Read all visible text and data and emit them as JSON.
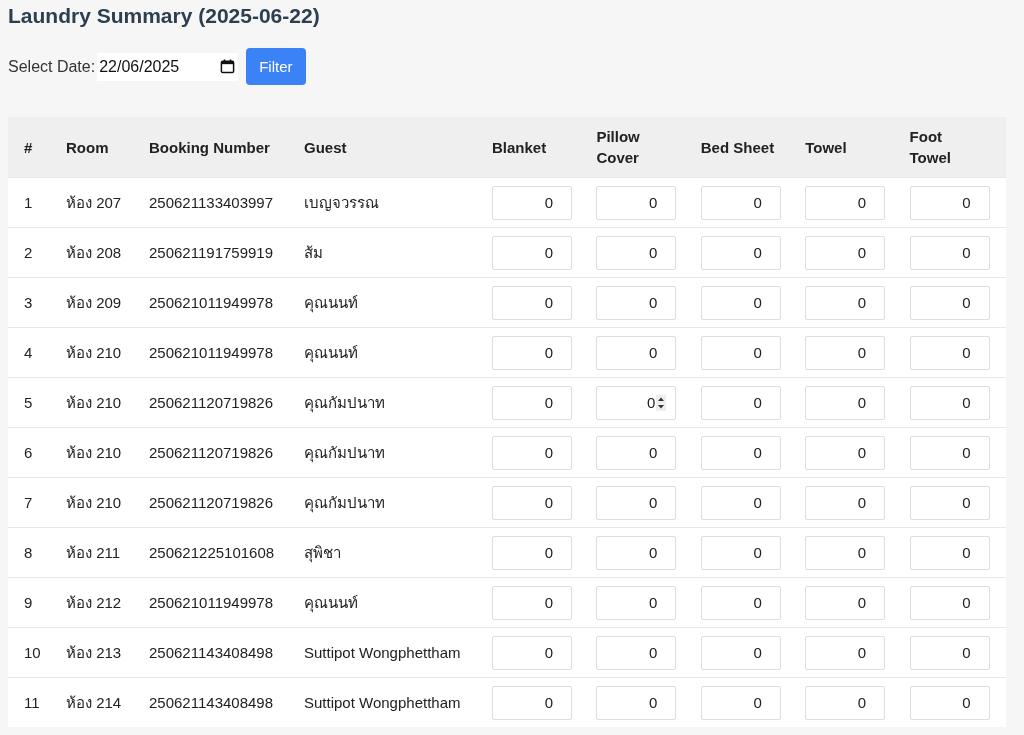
{
  "title": "Laundry Summary (2025-06-22)",
  "filter": {
    "label": "Select Date:",
    "date": "22/06/2025",
    "button": "Filter"
  },
  "table": {
    "columns": [
      "#",
      "Room",
      "Booking Number",
      "Guest",
      "Blanket",
      "Pillow Cover",
      "Bed Sheet",
      "Towel",
      "Foot Towel"
    ],
    "rows": [
      {
        "no": "1",
        "room": "ห้อง 207",
        "booking": "250621133403997",
        "guest": "เบญจวรรณ",
        "counts": [
          {
            "value": "0",
            "focused": false
          },
          {
            "value": "0",
            "focused": false
          },
          {
            "value": "0",
            "focused": false
          },
          {
            "value": "0",
            "focused": false
          },
          {
            "value": "0",
            "focused": false
          }
        ]
      },
      {
        "no": "2",
        "room": "ห้อง 208",
        "booking": "250621191759919",
        "guest": "ส้ม",
        "counts": [
          {
            "value": "0",
            "focused": false
          },
          {
            "value": "0",
            "focused": false
          },
          {
            "value": "0",
            "focused": false
          },
          {
            "value": "0",
            "focused": false
          },
          {
            "value": "0",
            "focused": false
          }
        ]
      },
      {
        "no": "3",
        "room": "ห้อง 209",
        "booking": "250621011949978",
        "guest": "คุณนนท์",
        "counts": [
          {
            "value": "0",
            "focused": false
          },
          {
            "value": "0",
            "focused": false
          },
          {
            "value": "0",
            "focused": false
          },
          {
            "value": "0",
            "focused": false
          },
          {
            "value": "0",
            "focused": false
          }
        ]
      },
      {
        "no": "4",
        "room": "ห้อง 210",
        "booking": "250621011949978",
        "guest": "คุณนนท์",
        "counts": [
          {
            "value": "0",
            "focused": false
          },
          {
            "value": "0",
            "focused": false
          },
          {
            "value": "0",
            "focused": false
          },
          {
            "value": "0",
            "focused": false
          },
          {
            "value": "0",
            "focused": false
          }
        ]
      },
      {
        "no": "5",
        "room": "ห้อง 210",
        "booking": "250621120719826",
        "guest": "คุณกัมปนาท",
        "counts": [
          {
            "value": "0",
            "focused": false
          },
          {
            "value": "0",
            "focused": true
          },
          {
            "value": "0",
            "focused": false
          },
          {
            "value": "0",
            "focused": false
          },
          {
            "value": "0",
            "focused": false
          }
        ]
      },
      {
        "no": "6",
        "room": "ห้อง 210",
        "booking": "250621120719826",
        "guest": "คุณกัมปนาท",
        "counts": [
          {
            "value": "0",
            "focused": false
          },
          {
            "value": "0",
            "focused": false
          },
          {
            "value": "0",
            "focused": false
          },
          {
            "value": "0",
            "focused": false
          },
          {
            "value": "0",
            "focused": false
          }
        ]
      },
      {
        "no": "7",
        "room": "ห้อง 210",
        "booking": "250621120719826",
        "guest": "คุณกัมปนาท",
        "counts": [
          {
            "value": "0",
            "focused": false
          },
          {
            "value": "0",
            "focused": false
          },
          {
            "value": "0",
            "focused": false
          },
          {
            "value": "0",
            "focused": false
          },
          {
            "value": "0",
            "focused": false
          }
        ]
      },
      {
        "no": "8",
        "room": "ห้อง 211",
        "booking": "250621225101608",
        "guest": "สุพิชา",
        "counts": [
          {
            "value": "0",
            "focused": false
          },
          {
            "value": "0",
            "focused": false
          },
          {
            "value": "0",
            "focused": false
          },
          {
            "value": "0",
            "focused": false
          },
          {
            "value": "0",
            "focused": false
          }
        ]
      },
      {
        "no": "9",
        "room": "ห้อง 212",
        "booking": "250621011949978",
        "guest": "คุณนนท์",
        "counts": [
          {
            "value": "0",
            "focused": false
          },
          {
            "value": "0",
            "focused": false
          },
          {
            "value": "0",
            "focused": false
          },
          {
            "value": "0",
            "focused": false
          },
          {
            "value": "0",
            "focused": false
          }
        ]
      },
      {
        "no": "10",
        "room": "ห้อง 213",
        "booking": "250621143408498",
        "guest": "Suttipot Wongphettham",
        "counts": [
          {
            "value": "0",
            "focused": false
          },
          {
            "value": "0",
            "focused": false
          },
          {
            "value": "0",
            "focused": false
          },
          {
            "value": "0",
            "focused": false
          },
          {
            "value": "0",
            "focused": false
          }
        ]
      },
      {
        "no": "11",
        "room": "ห้อง 214",
        "booking": "250621143408498",
        "guest": "Suttipot Wongphettham",
        "counts": [
          {
            "value": "0",
            "focused": false
          },
          {
            "value": "0",
            "focused": false
          },
          {
            "value": "0",
            "focused": false
          },
          {
            "value": "0",
            "focused": false
          },
          {
            "value": "0",
            "focused": false
          }
        ]
      }
    ]
  }
}
